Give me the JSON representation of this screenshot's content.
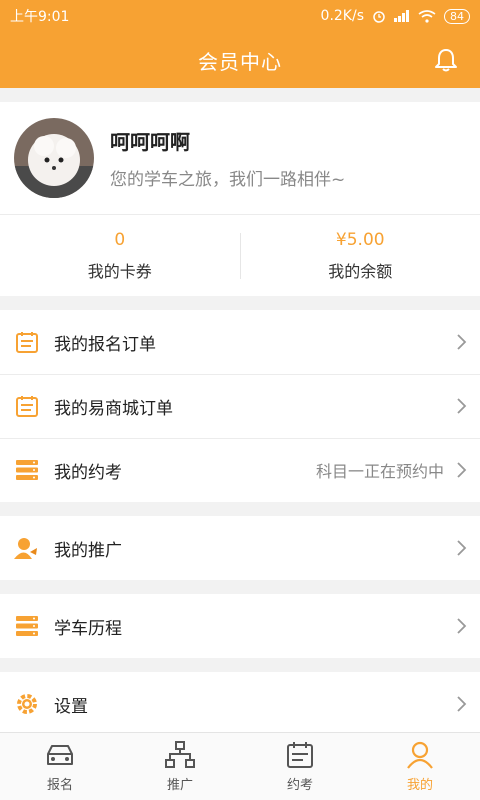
{
  "status_bar": {
    "time": "上午9:01",
    "speed": "0.2K/s",
    "battery": "84"
  },
  "header": {
    "title": "会员中心",
    "bell_icon": "bell-icon"
  },
  "profile": {
    "name": "呵呵呵啊",
    "slogan": "您的学车之旅，我们一路相伴~"
  },
  "stats": [
    {
      "value": "0",
      "label": "我的卡券"
    },
    {
      "value": "¥5.00",
      "label": "我的余额"
    }
  ],
  "menu_group_1": [
    {
      "label": "我的报名订单",
      "icon": "order-icon"
    },
    {
      "label": "我的易商城订单",
      "icon": "order-icon"
    },
    {
      "label": "我的约考",
      "icon": "list-icon",
      "extra": "科目一正在预约中"
    }
  ],
  "menu_group_2": [
    {
      "label": "我的推广",
      "icon": "user-share-icon"
    }
  ],
  "menu_group_3": [
    {
      "label": "学车历程",
      "icon": "list-icon"
    }
  ],
  "menu_group_4": [
    {
      "label": "设置",
      "icon": "gear-icon"
    }
  ],
  "tabbar": [
    {
      "label": "报名",
      "icon": "car-icon"
    },
    {
      "label": "推广",
      "icon": "network-icon"
    },
    {
      "label": "约考",
      "icon": "calendar-icon"
    },
    {
      "label": "我的",
      "icon": "user-icon"
    }
  ],
  "colors": {
    "accent": "#f7a233"
  }
}
